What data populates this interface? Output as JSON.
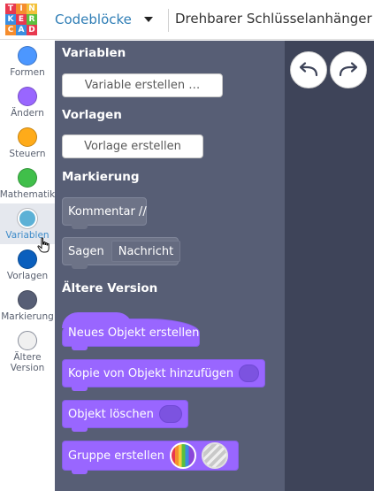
{
  "logo": {
    "letters": [
      "T",
      "I",
      "N",
      "K",
      "E",
      "R",
      "C",
      "A",
      "D"
    ],
    "colors": [
      "#e8384f",
      "#f58d2e",
      "#f3c13a",
      "#3b8ee0",
      "#e8384f",
      "#5bbf3e",
      "#f58d2e",
      "#3b8ee0",
      "#e8384f"
    ]
  },
  "header": {
    "mode": "Codeblöcke",
    "design_title": "Drehbarer Schlüsselanhänger"
  },
  "categories": [
    {
      "label": "Formen",
      "color": "#4c97ff",
      "active": false
    },
    {
      "label": "Ändern",
      "color": "#9966ff",
      "active": false
    },
    {
      "label": "Steuern",
      "color": "#ffab19",
      "active": false
    },
    {
      "label": "Mathematik",
      "color": "#40bf4a",
      "active": false
    },
    {
      "label": "Variablen",
      "color": "#5cb1d6",
      "active": true
    },
    {
      "label": "Vorlagen",
      "color": "#0b5fbd",
      "active": false
    },
    {
      "label": "Markierung",
      "color": "#575e75",
      "active": false
    },
    {
      "label": "Ältere Version",
      "label_line1": "Ältere",
      "label_line2": "Version",
      "color": "#f0f0f0",
      "active": false
    }
  ],
  "flyout": {
    "variables_heading": "Variablen",
    "create_variable_button": "Variable erstellen …",
    "templates_heading": "Vorlagen",
    "create_template_button": "Vorlage erstellen",
    "markup_heading": "Markierung",
    "comment_block": "Kommentar //",
    "say_block": "Sagen",
    "say_value": "Nachricht",
    "legacy_heading": "Ältere Version",
    "new_object_block": "Neues Objekt erstellen",
    "add_copy_block": "Kopie von Objekt hinzufügen",
    "delete_object_block": "Objekt löschen",
    "create_group_block": "Gruppe erstellen"
  },
  "workspace": {
    "undo_icon": "undo-arrow-icon",
    "redo_icon": "redo-arrow-icon"
  },
  "colors": {
    "flyout_bg": "#575e75",
    "workspace_bg": "#3e4459",
    "legacy_block": "#9966ff",
    "accent": "#2e7db5"
  }
}
